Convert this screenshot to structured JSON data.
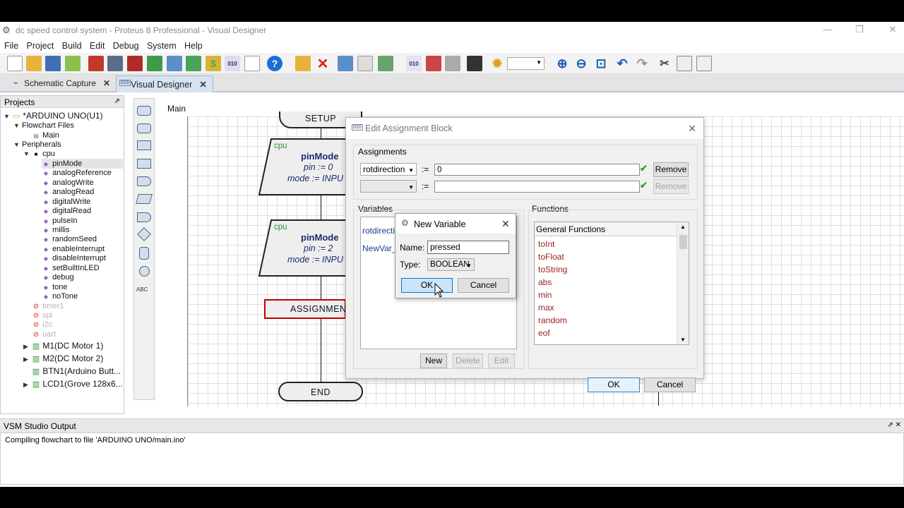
{
  "window": {
    "title": "dc speed control system - Proteus 8 Professional - Visual Designer",
    "minimize": "—",
    "maximize": "❐",
    "close": "✕"
  },
  "menu": [
    "File",
    "Project",
    "Build",
    "Edit",
    "Debug",
    "System",
    "Help"
  ],
  "tabs": [
    {
      "label": "Schematic Capture",
      "close": "✕"
    },
    {
      "label": "Visual Designer",
      "close": "✕"
    }
  ],
  "projects": {
    "header": "Projects",
    "pin": "⇗",
    "root": "*ARDUINO UNO(U1)",
    "flowchart_files": "Flowchart Files",
    "main": "Main",
    "peripherals": "Peripherals",
    "cpu": "cpu",
    "cpu_items": [
      "pinMode",
      "analogReference",
      "analogWrite",
      "analogRead",
      "digitalWrite",
      "digitalRead",
      "pulseIn",
      "millis",
      "randomSeed",
      "enableInterrupt",
      "disableInterrupt",
      "setBuiltInLED",
      "debug",
      "tone",
      "noTone"
    ],
    "disabled_items": [
      "timer1",
      "spi",
      "i2c",
      "uart"
    ],
    "components": [
      "M1(DC Motor 1)",
      "M2(DC Motor 2)",
      "BTN1(Arduino Butt...",
      "LCD1(Grove 128x6..."
    ]
  },
  "palette": {
    "text_tool": "ABC"
  },
  "canvas": {
    "tab": "Main",
    "setup": "SETUP",
    "blocks": [
      {
        "tag": "cpu",
        "name": "pinMode",
        "line1": "pin := 0",
        "line2": "mode := INPU"
      },
      {
        "tag": "cpu",
        "name": "pinMode",
        "line1": "pin := 2",
        "line2": "mode := INPU"
      }
    ],
    "assignment": "ASSIGNMENT",
    "end": "END"
  },
  "edit_dialog": {
    "title": "Edit Assignment Block",
    "close": "✕",
    "assignments_label": "Assignments",
    "rows": [
      {
        "variable": "rotdirection",
        "op": ":=",
        "value": "0",
        "remove": "Remove",
        "remove_enabled": true
      },
      {
        "variable": "",
        "op": ":=",
        "value": "",
        "remove": "Remove",
        "remove_enabled": false
      }
    ],
    "variables_label": "Variables",
    "variables": [
      "rotdirecti",
      "NewVar_"
    ],
    "new_btn": "New",
    "delete_btn": "Delete",
    "edit_btn": "Edit",
    "functions_label": "Functions",
    "functions_header": "General Functions",
    "functions": [
      "toInt",
      "toFloat",
      "toString",
      "abs",
      "min",
      "max",
      "random",
      "eof"
    ],
    "ok": "OK",
    "cancel": "Cancel"
  },
  "new_var_dialog": {
    "title": "New Variable",
    "close": "✕",
    "name_label": "Name:",
    "name_value": "pressed",
    "type_label": "Type:",
    "type_value": "BOOLEAN",
    "ok": "OK",
    "cancel": "Cancel"
  },
  "output": {
    "header": "VSM Studio Output",
    "pin": "⇗ ✕",
    "text": "Compiling flowchart to file 'ARDUINO UNO/main.ino'"
  },
  "colors": {
    "accent": "#2f7fd0",
    "function_red": "#9c1d1d",
    "check_green": "#2e9d3c",
    "block_tag_green": "#2f8f2f",
    "assignment_red": "#c00000"
  }
}
